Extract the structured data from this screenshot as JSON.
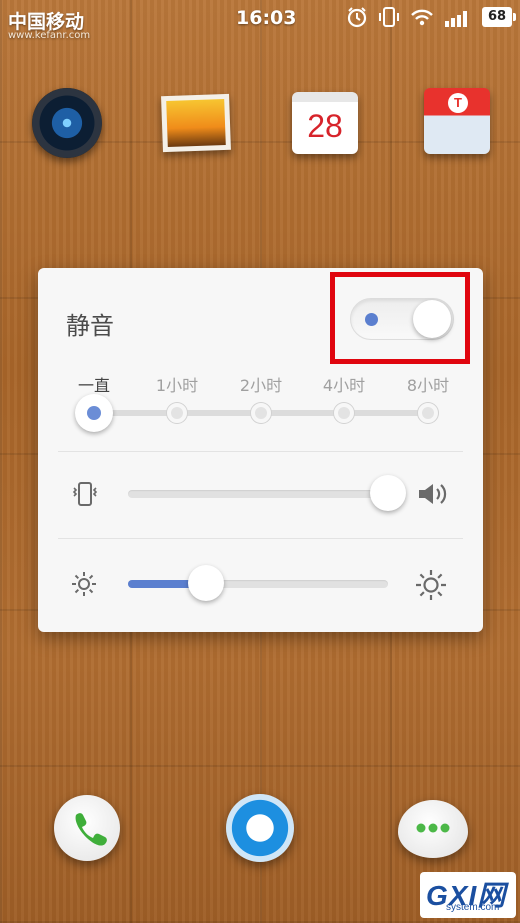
{
  "status_bar": {
    "carrier": "中国移动",
    "time": "16:03",
    "battery": "68",
    "watermark": "www.kefanr.com"
  },
  "home_apps": [
    {
      "icon": "camera-icon"
    },
    {
      "icon": "gallery-icon"
    },
    {
      "icon": "calendar-icon",
      "text": "28"
    },
    {
      "icon": "store-icon"
    }
  ],
  "panel": {
    "mute_label": "静音",
    "mute_enabled": true,
    "durations": [
      "一直",
      "1小时",
      "2小时",
      "4小时",
      "8小时"
    ],
    "selected_duration": "一直",
    "volume_level": 1.0,
    "brightness_level": 0.3
  },
  "dock": [
    {
      "icon": "phone-icon"
    },
    {
      "icon": "browser-icon"
    },
    {
      "icon": "messages-icon"
    }
  ],
  "site_logo": {
    "main": "GXI网",
    "sub": "system.com"
  },
  "colors": {
    "accent": "#5b7fcf",
    "highlight": "#e0060f",
    "panel_bg": "#f7f7f7"
  }
}
